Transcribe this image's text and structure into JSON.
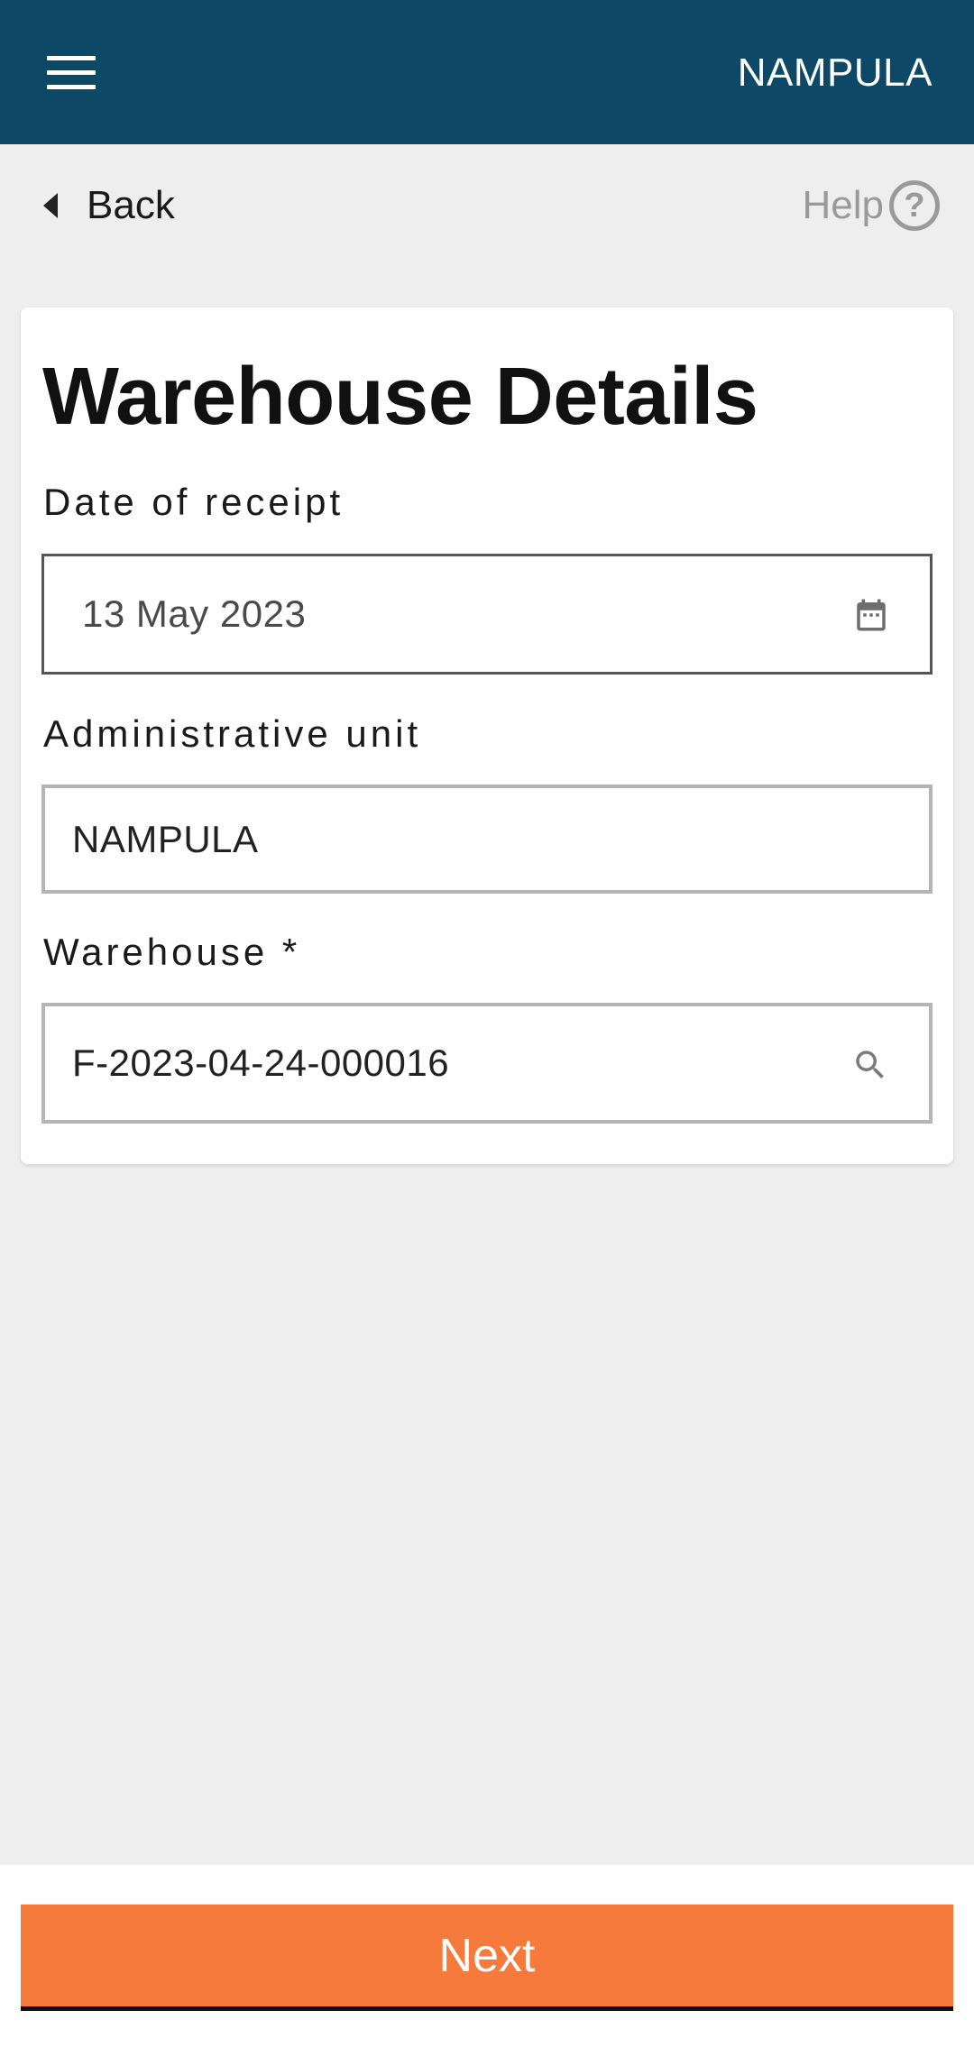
{
  "header": {
    "title": "NAMPULA",
    "menu_icon": "hamburger-menu-icon"
  },
  "nav": {
    "back_label": "Back",
    "help_label": "Help",
    "help_icon_glyph": "?"
  },
  "form": {
    "title": "Warehouse Details",
    "date_of_receipt": {
      "label": "Date of receipt",
      "value": "13 May 2023",
      "icon": "calendar-icon"
    },
    "administrative_unit": {
      "label": "Administrative unit",
      "value": "NAMPULA"
    },
    "warehouse": {
      "label": "Warehouse *",
      "value": "F-2023-04-24-000016",
      "icon": "search-icon"
    }
  },
  "footer": {
    "next_label": "Next"
  },
  "colors": {
    "appbar": "#0d4866",
    "accent": "#f57a3c",
    "background": "#eeeeee"
  }
}
